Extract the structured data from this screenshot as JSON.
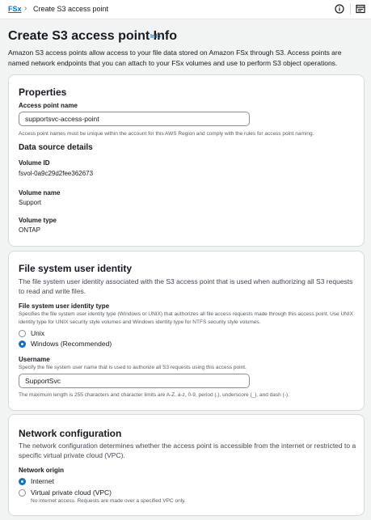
{
  "breadcrumb": {
    "parent": "FSx",
    "current": "Create S3 access point"
  },
  "icons": {
    "info": "info-circle-icon",
    "panel": "external-panel-icon",
    "chevron": "chevron-right-icon"
  },
  "header": {
    "title": "Create S3 access point",
    "info_link": "Info",
    "title_info_link": "Info",
    "description": "Amazon S3 access points allow access to your file data stored on Amazon FSx through S3. Access points are named network endpoints that you can attach to your FSx volumes and use to perform S3 object operations."
  },
  "properties": {
    "heading": "Properties",
    "access_point_name": {
      "label": "Access point name",
      "value": "supportsvc-access-point",
      "hint": "Access point names must be unique within the account for this AWS Region and comply with the rules for access point naming."
    },
    "data_source": {
      "heading": "Data source details",
      "volume_id_label": "Volume ID",
      "volume_id": "fsvol-0a9c29d2fee362673",
      "volume_name_label": "Volume name",
      "volume_name": "Support",
      "volume_type_label": "Volume type",
      "volume_type": "ONTAP"
    }
  },
  "identity": {
    "heading": "File system user identity",
    "description": "The file system user identity associated with the S3 access point that is used when authorizing all S3 requests to read and write files.",
    "type_label": "File system user identity type",
    "type_hint": "Specifies the file system user identity type (Windows or UNIX) that authorizes all file access requests made through this access point. Use UNIX identity type for UNIX security style volumes and Windows identity type for NTFS security style volumes.",
    "options": [
      {
        "label": "Unix",
        "checked": false
      },
      {
        "label": "Windows (Recommended)",
        "checked": true
      }
    ],
    "username_label": "Username",
    "username_hint": "Specify the file system user name that is used to authorize all S3 requests using this access point.",
    "username_value": "SupportSvc",
    "username_constraint": "The maximum length is 255 characters and character limits are A-Z, a-z, 0-9, period (.), underscore (_), and dash (-)."
  },
  "network": {
    "heading": "Network configuration",
    "description": "The network configuration determines whether the access point is accessible from the internet or restricted to a specific virtual private cloud (VPC).",
    "origin_label": "Network origin",
    "options": [
      {
        "label": "Internet",
        "checked": true
      },
      {
        "label": "Virtual private cloud (VPC)",
        "checked": false
      }
    ],
    "vpc_hint": "No internet access. Requests are made over a specified VPC only."
  },
  "colors": {
    "accent": "#0972d3",
    "text": "#16191f",
    "muted": "#545b64",
    "background": "#f2f3f3",
    "border": "#d5dbdb"
  }
}
